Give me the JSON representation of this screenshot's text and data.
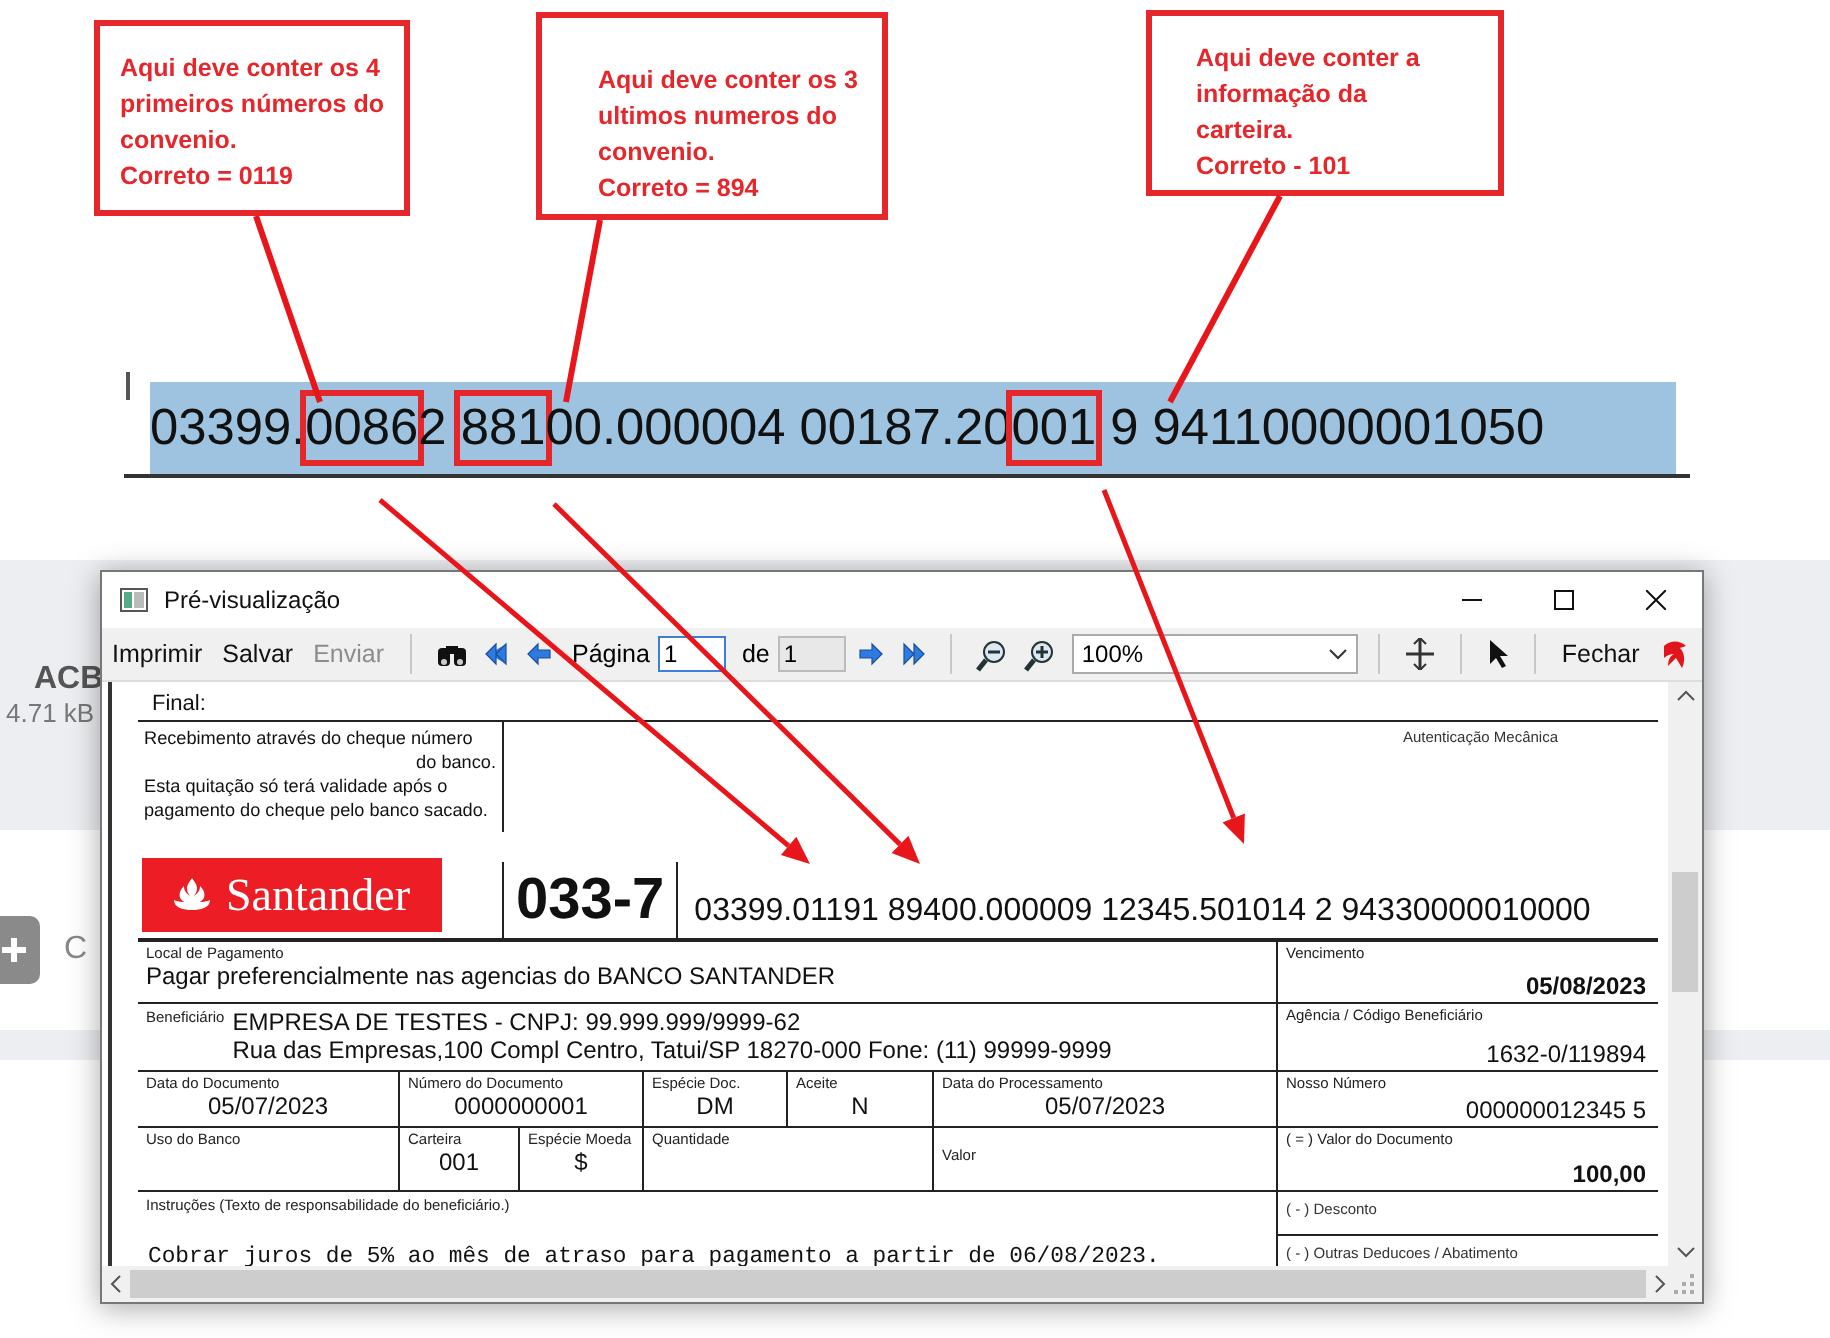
{
  "callouts": [
    {
      "lines": [
        "Aqui deve conter os 4",
        "primeiros números do",
        "convenio.",
        "Correto = 0119"
      ]
    },
    {
      "lines": [
        "Aqui deve conter os 3",
        "ultimos numeros do",
        "convenio.",
        "Correto = 894"
      ]
    },
    {
      "lines": [
        "Aqui deve conter a",
        "informação da",
        "carteira.",
        "Correto - 101"
      ]
    }
  ],
  "barcode_line": {
    "segments": [
      {
        "text": "03399.",
        "boxed": false
      },
      {
        "text": "0086",
        "boxed": true
      },
      {
        "text": "2 ",
        "boxed": false
      },
      {
        "text": "881",
        "boxed": true
      },
      {
        "text": "00.000004 00187.20",
        "boxed": false
      },
      {
        "text": "001",
        "boxed": true
      },
      {
        "text": " 9 94110000001050",
        "boxed": false
      }
    ]
  },
  "background": {
    "file_name": "ACB",
    "file_size": "4.71 kB",
    "side_text": "C"
  },
  "window": {
    "title": "Pré-visualização",
    "toolbar": [
      {
        "kind": "button",
        "label": "Imprimir",
        "disabled": false
      },
      {
        "kind": "button",
        "label": "Salvar",
        "disabled": false
      },
      {
        "kind": "button",
        "label": "Enviar",
        "disabled": true
      },
      {
        "kind": "separator"
      },
      {
        "kind": "find"
      },
      {
        "kind": "first"
      },
      {
        "kind": "prev"
      },
      {
        "kind": "page",
        "label": "Página",
        "value": "1",
        "of_label": "de",
        "total": "1"
      },
      {
        "kind": "next"
      },
      {
        "kind": "last"
      },
      {
        "kind": "separator"
      },
      {
        "kind": "zoom-out"
      },
      {
        "kind": "zoom-in"
      },
      {
        "kind": "zoom",
        "value": "100%"
      },
      {
        "kind": "separator"
      },
      {
        "kind": "fit"
      },
      {
        "kind": "separator"
      },
      {
        "kind": "select"
      },
      {
        "kind": "separator"
      },
      {
        "kind": "button",
        "label": "Fechar",
        "disabled": false
      },
      {
        "kind": "logo"
      }
    ]
  },
  "boleto": {
    "final_label": "Final:",
    "receipt": {
      "lines": [
        {
          "text": "Recebimento através do cheque número",
          "right": false
        },
        {
          "text": "do banco.",
          "right": true
        },
        {
          "text": "Esta quitação só terá validade após o",
          "right": false
        },
        {
          "text": "pagamento do cheque pelo banco sacado.",
          "right": false
        }
      ],
      "auth": "Autenticação Mecânica"
    },
    "bank": {
      "logo": "Santander",
      "code": "033-7",
      "line": "03399.01191 89400.000009 12345.501014 2 94330000010000"
    },
    "rows": [
      {
        "cells": [
          {
            "label": "Local de Pagamento",
            "value": "Pagar preferencialmente nas agencias do BANCO SANTANDER"
          }
        ],
        "right": {
          "label": "Vencimento",
          "value": "05/08/2023"
        }
      },
      {
        "beneficiary": {
          "label": "Beneficiário",
          "lines": [
            "EMPRESA DE TESTES - CNPJ: 99.999.999/9999-62",
            "Rua das Empresas,100 Compl Centro, Tatui/SP 18270-000 Fone: (11) 99999-9999"
          ]
        },
        "right": {
          "label": "Agência / Código Beneficiário",
          "value": "1632-0/119894"
        }
      },
      {
        "cells": [
          {
            "label": "Data do Documento",
            "value": "05/07/2023"
          },
          {
            "label": "Número do Documento",
            "value": "0000000001"
          },
          {
            "label": "Espécie Doc.",
            "value": "DM"
          },
          {
            "label": "Aceite",
            "value": "N"
          },
          {
            "label": "Data do Processamento",
            "value": "05/07/2023"
          }
        ],
        "right": {
          "label": "Nosso Número",
          "value": "000000012345 5"
        }
      },
      {
        "cells": [
          {
            "label": "Uso do Banco"
          },
          {
            "label": "Carteira",
            "value": "001"
          },
          {
            "label": "Espécie Moeda",
            "value": "$"
          },
          {
            "label": "Quantidade"
          },
          {
            "label": "Valor"
          }
        ],
        "right": {
          "label": "( = ) Valor do Documento",
          "value": "100,00"
        }
      }
    ],
    "instructions": {
      "label": "Instruções (Texto de responsabilidade do beneficiário.)",
      "text": "Cobrar juros de 5% ao mês de atraso para pagamento a partir de 06/08/2023."
    },
    "deductions": [
      "( - ) Desconto",
      "( - ) Outras Deducoes / Abatimento"
    ]
  }
}
